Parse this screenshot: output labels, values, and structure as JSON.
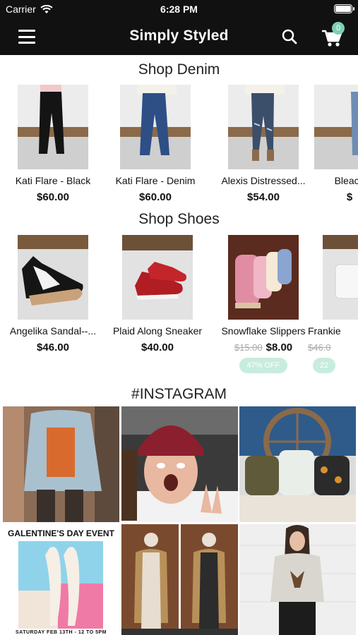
{
  "status_bar": {
    "carrier": "Carrier",
    "time": "6:28 PM"
  },
  "nav": {
    "title": "Simply Styled",
    "cart_count": "0"
  },
  "sections": {
    "denim": {
      "title": "Shop Denim",
      "products": [
        {
          "name": "Kati Flare - Black",
          "price": "$60.00"
        },
        {
          "name": "Kati Flare - Denim",
          "price": "$60.00"
        },
        {
          "name": "Alexis Distressed...",
          "price": "$54.00"
        },
        {
          "name": "Bleach",
          "price": "$"
        }
      ]
    },
    "shoes": {
      "title": "Shop Shoes",
      "products": [
        {
          "name": "Angelika Sandal--...",
          "price": "$46.00"
        },
        {
          "name": "Plaid Along Sneaker",
          "price": "$40.00"
        },
        {
          "name": "Snowflake Slippers",
          "old_price": "$15.00",
          "price": "$8.00",
          "badge": "47% OFF"
        },
        {
          "name": "Frankie",
          "old_price": "$46.0",
          "badge": "22"
        }
      ]
    },
    "instagram": {
      "title": "#INSTAGRAM",
      "posts": [
        {
          "caption": ""
        },
        {
          "caption": ""
        },
        {
          "caption": ""
        },
        {
          "caption": "GALENTINE'S DAY EVENT",
          "footer": "SATURDAY FEB 13TH - 12 TO 5PM"
        },
        {
          "caption": ""
        },
        {
          "caption": ""
        }
      ]
    }
  },
  "colors": {
    "bar": "#111111",
    "accent": "#7fcfb2",
    "badge": "#c8ecdd"
  }
}
